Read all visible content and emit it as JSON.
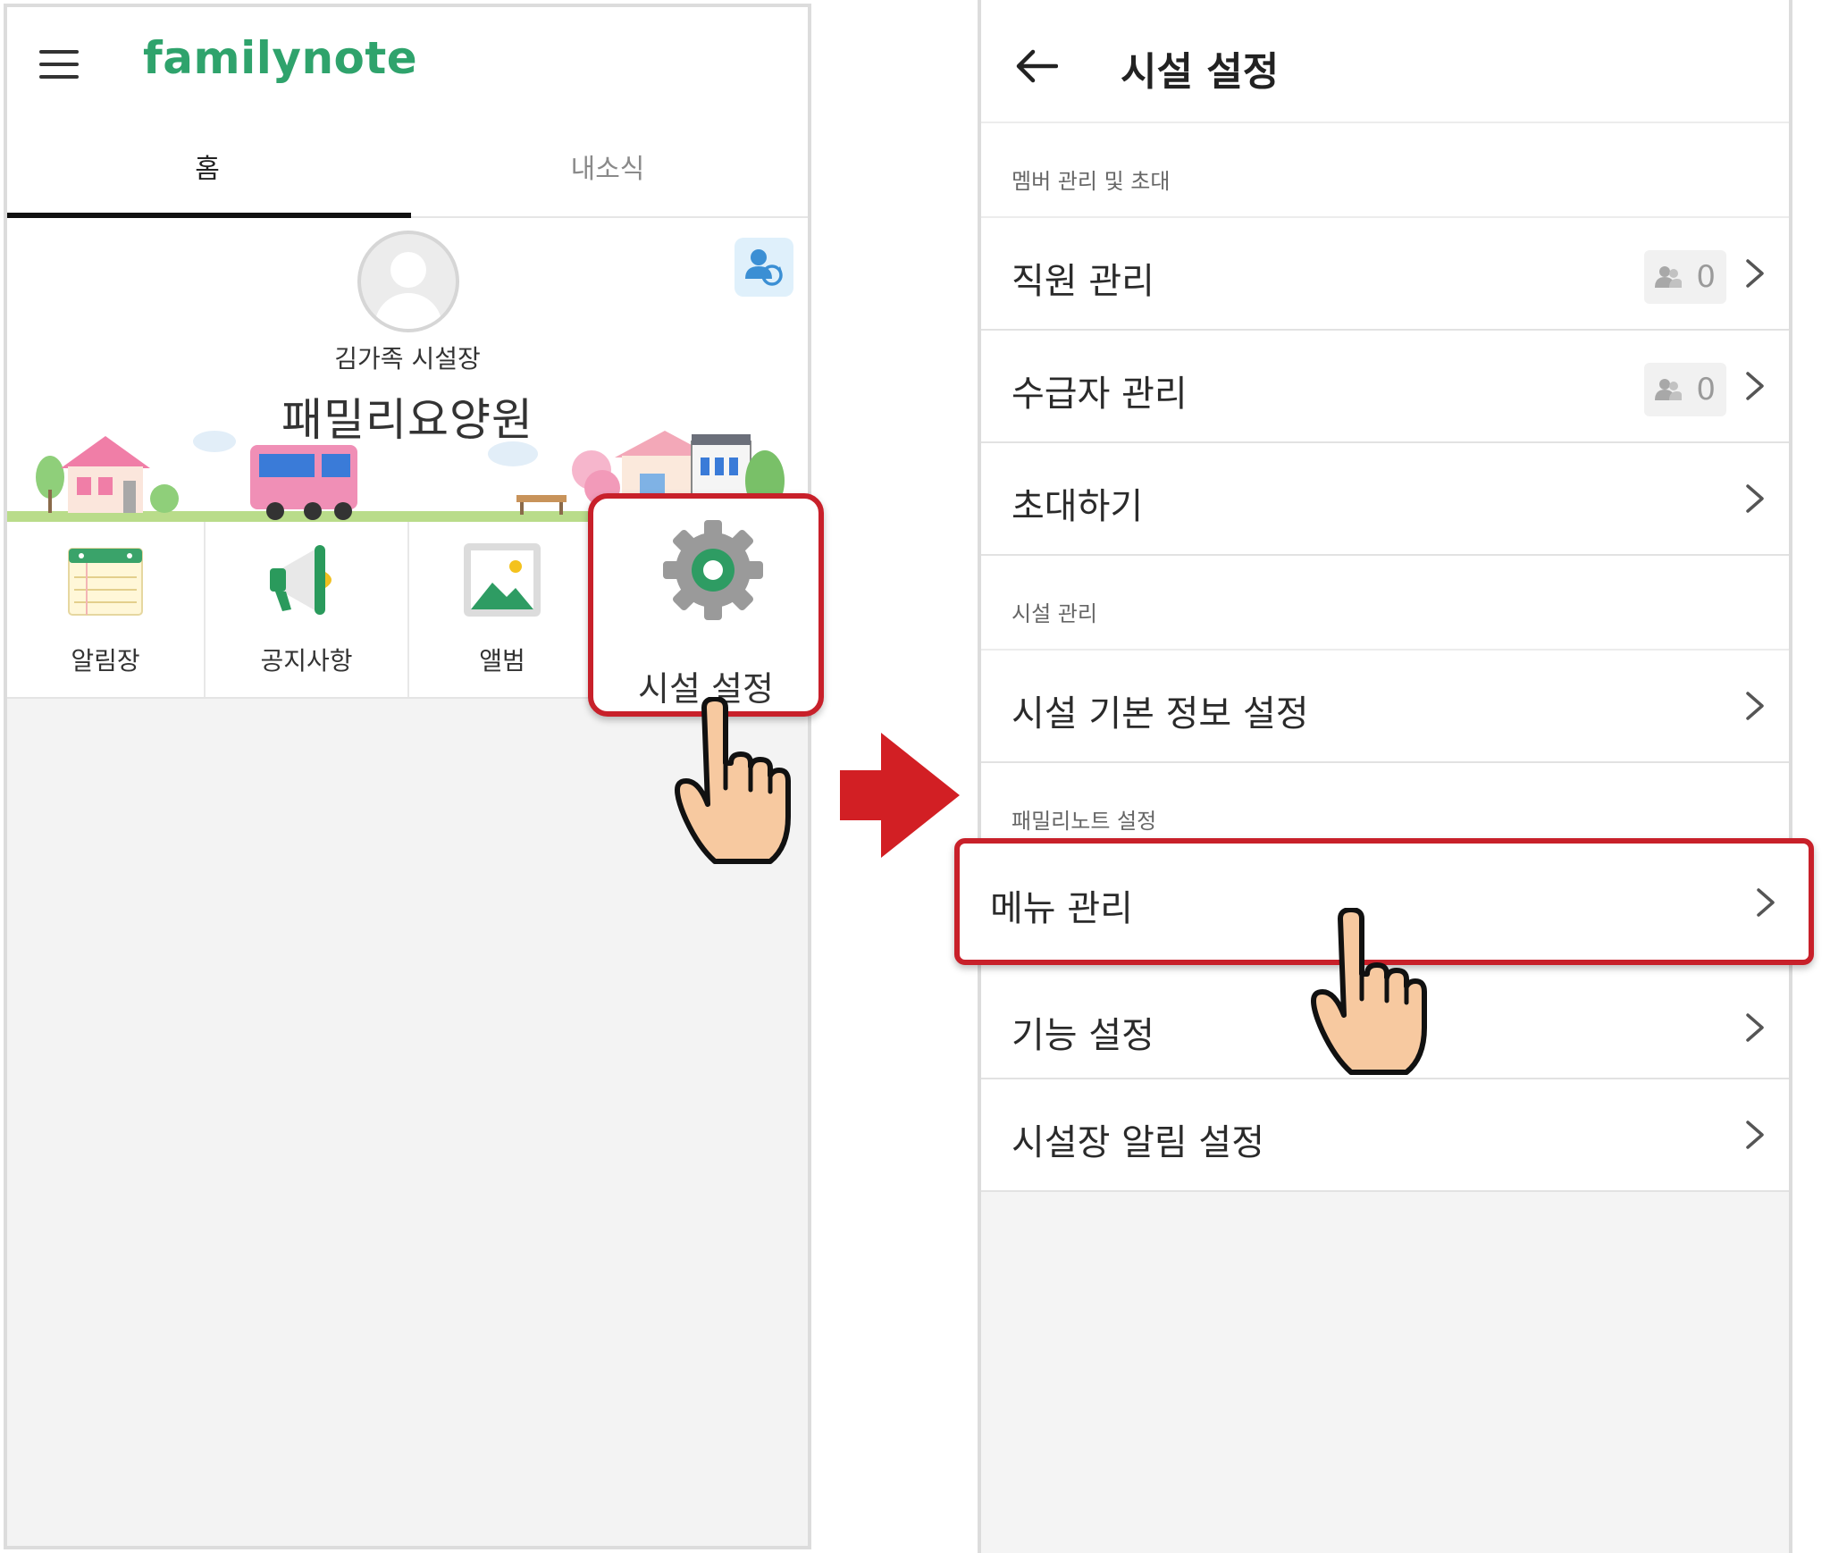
{
  "left": {
    "logo": "familynote",
    "tabs": [
      {
        "label": "홈",
        "active": true
      },
      {
        "label": "내소식",
        "active": false
      }
    ],
    "profile": {
      "director": "김가족 시설장",
      "facility": "패밀리요양원"
    },
    "menu": [
      {
        "label": "알림장",
        "icon": "notebook-icon"
      },
      {
        "label": "공지사항",
        "icon": "megaphone-icon"
      },
      {
        "label": "앨범",
        "icon": "photo-album-icon"
      },
      {
        "label": "시설 설정",
        "icon": "gear-icon"
      }
    ]
  },
  "right": {
    "title": "시설 설정",
    "sections": [
      {
        "header": "멤버 관리 및 초대",
        "items": [
          {
            "label": "직원 관리",
            "count": "0"
          },
          {
            "label": "수급자 관리",
            "count": "0"
          },
          {
            "label": "초대하기"
          }
        ]
      },
      {
        "header": "시설 관리",
        "items": [
          {
            "label": "시설 기본 정보 설정"
          }
        ]
      },
      {
        "header": "패밀리노트 설정",
        "items": [
          {
            "label": "메뉴 관리"
          },
          {
            "label": "기능 설정"
          },
          {
            "label": "시설장 알림 설정"
          }
        ]
      }
    ]
  },
  "colors": {
    "brand": "#2fa36c",
    "highlight": "#c8202a",
    "hand": "#f7c9a0"
  }
}
